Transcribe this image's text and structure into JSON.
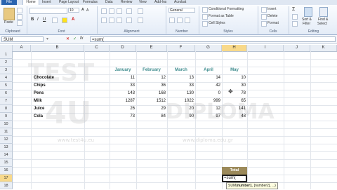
{
  "ribbon_tabs": [
    "File",
    "Home",
    "Insert",
    "Page Layout",
    "Formulas",
    "Data",
    "Review",
    "View",
    "Add-Ins",
    "Acrobat"
  ],
  "clipboard": {
    "paste": "Paste",
    "group": "Clipboard"
  },
  "font": {
    "group": "Font",
    "size": "10"
  },
  "alignment": {
    "group": "Alignment"
  },
  "number": {
    "format": "General",
    "group": "Number"
  },
  "styles": {
    "conditional": "Conditional Formatting",
    "format_table": "Format as Table",
    "cell_styles": "Cell Styles",
    "group": "Styles"
  },
  "cells": {
    "insert": "Insert",
    "delete": "Delete",
    "format": "Format",
    "group": "Cells"
  },
  "editing": {
    "sort": "Sort &",
    "filter": "Filter",
    "find": "Find &",
    "select": "Select",
    "group": "Editing"
  },
  "formula_bar": {
    "name_box": "SUM",
    "formula": "=sum("
  },
  "columns": [
    "A",
    "B",
    "C",
    "D",
    "E",
    "F",
    "G",
    "H",
    "I",
    "J",
    "K"
  ],
  "rows": [
    "1",
    "2",
    "3",
    "4",
    "5",
    "6",
    "7",
    "8",
    "9",
    "10",
    "11",
    "12",
    "13",
    "14",
    "15",
    "16",
    "17",
    "18",
    "19"
  ],
  "table": {
    "months": [
      "January",
      "February",
      "March",
      "April",
      "May"
    ],
    "items": [
      {
        "name": "Chocolate",
        "values": [
          "11",
          "12",
          "13",
          "14",
          "10"
        ]
      },
      {
        "name": "Chips",
        "values": [
          "33",
          "36",
          "33",
          "42",
          "30"
        ]
      },
      {
        "name": "Pens",
        "values": [
          "143",
          "168",
          "130",
          "0",
          "78"
        ]
      },
      {
        "name": "Milk",
        "values": [
          "1287",
          "1512",
          "1022",
          "999",
          "65"
        ]
      },
      {
        "name": "Juice",
        "values": [
          "26",
          "29",
          "20",
          "12",
          "141"
        ]
      },
      {
        "name": "Cola",
        "values": [
          "73",
          "84",
          "90",
          "97",
          "48"
        ]
      }
    ]
  },
  "total": {
    "label": "Total",
    "editing": "=sum("
  },
  "tooltip": {
    "fn": "SUM(",
    "arg1": "number1",
    "rest": ", [number2], ...)"
  },
  "watermark": {
    "top_left": "TEST",
    "big_left": "4U",
    "right": "DIPLOMA",
    "url_left": "www.test4u.eu",
    "url_right": "www.diploma.edu.gr"
  },
  "colors": {
    "header_teal": "#3d8b8d",
    "selected_header": "#f8d98a",
    "total_fill": "#9c8a5a"
  }
}
